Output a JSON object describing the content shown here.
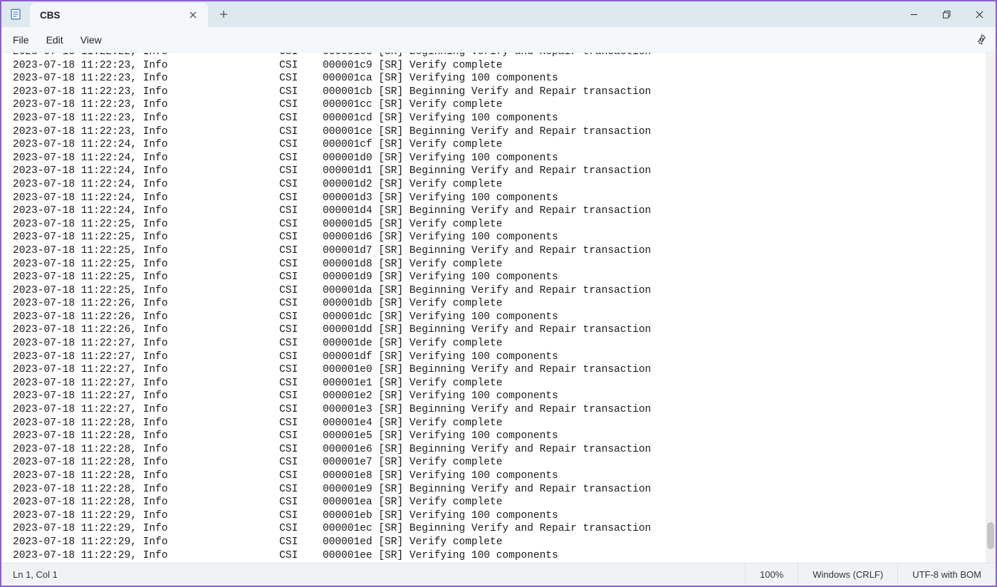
{
  "window": {
    "tab_title": "CBS"
  },
  "menu": {
    "file": "File",
    "edit": "Edit",
    "view": "View"
  },
  "log_lines": [
    "2023-07-18 11:22:23, Info                  CSI    000001c9 [SR] Verify complete",
    "2023-07-18 11:22:23, Info                  CSI    000001ca [SR] Verifying 100 components",
    "2023-07-18 11:22:23, Info                  CSI    000001cb [SR] Beginning Verify and Repair transaction",
    "2023-07-18 11:22:23, Info                  CSI    000001cc [SR] Verify complete",
    "2023-07-18 11:22:23, Info                  CSI    000001cd [SR] Verifying 100 components",
    "2023-07-18 11:22:23, Info                  CSI    000001ce [SR] Beginning Verify and Repair transaction",
    "2023-07-18 11:22:24, Info                  CSI    000001cf [SR] Verify complete",
    "2023-07-18 11:22:24, Info                  CSI    000001d0 [SR] Verifying 100 components",
    "2023-07-18 11:22:24, Info                  CSI    000001d1 [SR] Beginning Verify and Repair transaction",
    "2023-07-18 11:22:24, Info                  CSI    000001d2 [SR] Verify complete",
    "2023-07-18 11:22:24, Info                  CSI    000001d3 [SR] Verifying 100 components",
    "2023-07-18 11:22:24, Info                  CSI    000001d4 [SR] Beginning Verify and Repair transaction",
    "2023-07-18 11:22:25, Info                  CSI    000001d5 [SR] Verify complete",
    "2023-07-18 11:22:25, Info                  CSI    000001d6 [SR] Verifying 100 components",
    "2023-07-18 11:22:25, Info                  CSI    000001d7 [SR] Beginning Verify and Repair transaction",
    "2023-07-18 11:22:25, Info                  CSI    000001d8 [SR] Verify complete",
    "2023-07-18 11:22:25, Info                  CSI    000001d9 [SR] Verifying 100 components",
    "2023-07-18 11:22:25, Info                  CSI    000001da [SR] Beginning Verify and Repair transaction",
    "2023-07-18 11:22:26, Info                  CSI    000001db [SR] Verify complete",
    "2023-07-18 11:22:26, Info                  CSI    000001dc [SR] Verifying 100 components",
    "2023-07-18 11:22:26, Info                  CSI    000001dd [SR] Beginning Verify and Repair transaction",
    "2023-07-18 11:22:27, Info                  CSI    000001de [SR] Verify complete",
    "2023-07-18 11:22:27, Info                  CSI    000001df [SR] Verifying 100 components",
    "2023-07-18 11:22:27, Info                  CSI    000001e0 [SR] Beginning Verify and Repair transaction",
    "2023-07-18 11:22:27, Info                  CSI    000001e1 [SR] Verify complete",
    "2023-07-18 11:22:27, Info                  CSI    000001e2 [SR] Verifying 100 components",
    "2023-07-18 11:22:27, Info                  CSI    000001e3 [SR] Beginning Verify and Repair transaction",
    "2023-07-18 11:22:28, Info                  CSI    000001e4 [SR] Verify complete",
    "2023-07-18 11:22:28, Info                  CSI    000001e5 [SR] Verifying 100 components",
    "2023-07-18 11:22:28, Info                  CSI    000001e6 [SR] Beginning Verify and Repair transaction",
    "2023-07-18 11:22:28, Info                  CSI    000001e7 [SR] Verify complete",
    "2023-07-18 11:22:28, Info                  CSI    000001e8 [SR] Verifying 100 components",
    "2023-07-18 11:22:28, Info                  CSI    000001e9 [SR] Beginning Verify and Repair transaction",
    "2023-07-18 11:22:28, Info                  CSI    000001ea [SR] Verify complete",
    "2023-07-18 11:22:29, Info                  CSI    000001eb [SR] Verifying 100 components",
    "2023-07-18 11:22:29, Info                  CSI    000001ec [SR] Beginning Verify and Repair transaction",
    "2023-07-18 11:22:29, Info                  CSI    000001ed [SR] Verify complete",
    "2023-07-18 11:22:29, Info                  CSI    000001ee [SR] Verifying 100 components"
  ],
  "status": {
    "cursor": "Ln 1, Col 1",
    "zoom": "100%",
    "line_ending": "Windows (CRLF)",
    "encoding": "UTF-8 with BOM"
  }
}
